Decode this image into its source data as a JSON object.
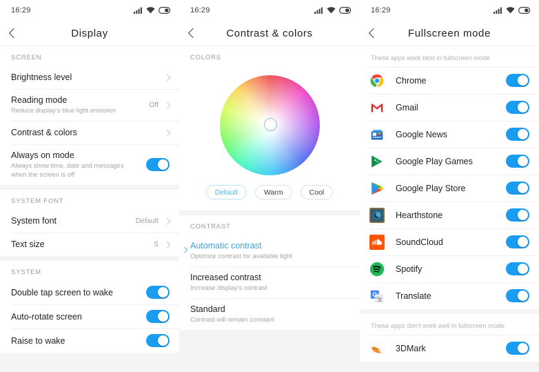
{
  "status": {
    "time": "16:29",
    "icons": [
      "signal-icon",
      "wifi-icon",
      "battery-icon"
    ]
  },
  "panel_display": {
    "title": "Display",
    "back_icon": "back-chevron-icon",
    "sections": [
      {
        "header": "SCREEN",
        "rows": [
          {
            "title": "Brightness level",
            "sub": "",
            "value": "",
            "control": "chevron"
          },
          {
            "title": "Reading mode",
            "sub": "Reduce display's blue light emission",
            "value": "Off",
            "control": "chevron"
          },
          {
            "title": "Contrast & colors",
            "sub": "",
            "value": "",
            "control": "chevron"
          },
          {
            "title": "Always on mode",
            "sub": "Always show time, date and messages when the screen is off",
            "value": "",
            "control": "toggle",
            "on": true
          }
        ]
      },
      {
        "header": "SYSTEM FONT",
        "rows": [
          {
            "title": "System font",
            "sub": "",
            "value": "Default",
            "control": "chevron"
          },
          {
            "title": "Text size",
            "sub": "",
            "value": "S",
            "control": "chevron"
          }
        ]
      },
      {
        "header": "SYSTEM",
        "rows": [
          {
            "title": "Double tap screen to wake",
            "sub": "",
            "value": "",
            "control": "toggle",
            "on": true
          },
          {
            "title": "Auto-rotate screen",
            "sub": "",
            "value": "",
            "control": "toggle",
            "on": true
          },
          {
            "title": "Raise to wake",
            "sub": "",
            "value": "",
            "control": "toggle",
            "on": true
          }
        ]
      }
    ]
  },
  "panel_contrast": {
    "title": "Contrast  &  colors",
    "back_icon": "back-chevron-icon",
    "colors_header": "COLORS",
    "wheel": {
      "name": "color-wheel",
      "cursor": "color-wheel-cursor"
    },
    "chips": [
      {
        "label": "Default",
        "active": true
      },
      {
        "label": "Warm",
        "active": false
      },
      {
        "label": "Cool",
        "active": false
      }
    ],
    "contrast_header": "CONTRAST",
    "options": [
      {
        "title": "Automatic contrast",
        "sub": "Optimize contrast for available light",
        "selected": true
      },
      {
        "title": "Increased contrast",
        "sub": "Increase display's contrast",
        "selected": false
      },
      {
        "title": "Standard",
        "sub": "Contrast will remain constant",
        "selected": false
      }
    ]
  },
  "panel_fullscreen": {
    "title": "Fullscreen mode",
    "back_icon": "back-chevron-icon",
    "hint_good": "These apps work best in fullscreen mode",
    "hint_bad": "These apps don't work well in fullscreen mode",
    "apps_good": [
      {
        "name": "Chrome",
        "icon": "chrome-icon",
        "on": true
      },
      {
        "name": "Gmail",
        "icon": "gmail-icon",
        "on": true
      },
      {
        "name": "Google News",
        "icon": "google-news-icon",
        "on": true
      },
      {
        "name": "Google Play Games",
        "icon": "google-play-games-icon",
        "on": true
      },
      {
        "name": "Google Play Store",
        "icon": "google-play-store-icon",
        "on": true
      },
      {
        "name": "Hearthstone",
        "icon": "hearthstone-icon",
        "on": true
      },
      {
        "name": "SoundCloud",
        "icon": "soundcloud-icon",
        "on": true
      },
      {
        "name": "Spotify",
        "icon": "spotify-icon",
        "on": true
      },
      {
        "name": "Translate",
        "icon": "google-translate-icon",
        "on": true
      }
    ],
    "apps_bad": [
      {
        "name": "3DMark",
        "icon": "3dmark-icon",
        "on": true
      }
    ]
  },
  "colors": {
    "accent": "#1a9cf0",
    "selected_text": "#42a5dd",
    "muted": "#9e9e9e"
  }
}
